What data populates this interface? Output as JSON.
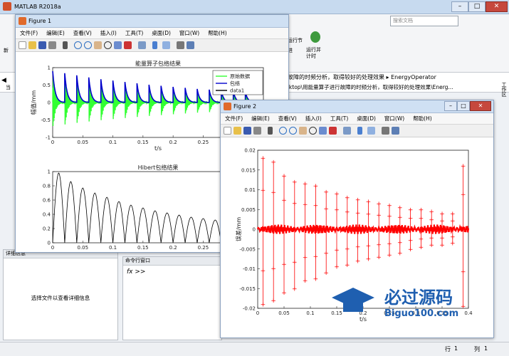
{
  "app": {
    "title": "MATLAB R2018a",
    "search_placeholder": "搜索文档"
  },
  "ribbon": {
    "run_section_label": "运行节",
    "run_advance_label": "运行并\n计时",
    "advance_label": "进"
  },
  "path": {
    "line1": "故障的时频分析，取得较好的处理效果 ▸ EnergyOperator",
    "line2": "sktop\\用能量算子进行故障的时频分析，取得较好的处理效果\\Energ..."
  },
  "side_tab": "工作区",
  "current_folder_short": "当",
  "details_panel": {
    "title": "详细信息",
    "message": "选择文件以查看详细信息"
  },
  "command_window": {
    "title": "命令行窗口",
    "prompt": "fx >>"
  },
  "status": {
    "row_label": "行",
    "row_value": "1",
    "col_label": "列",
    "col_value": "1"
  },
  "figure_menu": [
    "文件(F)",
    "编辑(E)",
    "查看(V)",
    "插入(I)",
    "工具(T)",
    "桌面(D)",
    "窗口(W)",
    "帮助(H)"
  ],
  "figure1": {
    "title": "Figure 1",
    "chart_data": [
      {
        "type": "line",
        "title": "能量算子包络结果",
        "xlabel": "t/s",
        "ylabel": "幅值/mm",
        "xlim": [
          0,
          0.35
        ],
        "ylim": [
          -1,
          1
        ],
        "xticks": [
          "0",
          "0.05",
          "0.1",
          "0.15",
          "0.2",
          "0.25",
          "0.3"
        ],
        "yticks": [
          "-1",
          "-0.5",
          "0",
          "0.5",
          "1"
        ],
        "legend_position": "top-right",
        "series": [
          {
            "name": "原始数据",
            "color": "#33ff33",
            "style": "damped oscillation bursts",
            "peak_envelope": [
              0.88,
              0.82,
              0.76,
              0.71,
              0.66,
              0.62,
              0.58,
              0.54,
              0.5,
              0.47,
              0.44,
              0.41,
              0.38,
              0.36,
              0.34,
              0.32,
              0.3
            ]
          },
          {
            "name": "包络",
            "color": "#0000cc",
            "peak_envelope": [
              0.9,
              0.84,
              0.78,
              0.72,
              0.67,
              0.63,
              0.59,
              0.55,
              0.51,
              0.48,
              0.45,
              0.42,
              0.39,
              0.37,
              0.35,
              0.33,
              0.31
            ]
          },
          {
            "name": "data1",
            "color": "#000000"
          }
        ],
        "burst_period_s": 0.02
      },
      {
        "type": "line",
        "title": "Hibert包络结果",
        "xlabel": "",
        "ylabel": "",
        "xlim": [
          0,
          0.35
        ],
        "ylim": [
          0,
          1
        ],
        "xticks": [
          "0",
          "0.05",
          "0.1",
          "0.15",
          "0.2",
          "0.25",
          "0.3"
        ],
        "yticks": [
          "0",
          "0.2",
          "0.4",
          "0.6",
          "0.8",
          "1"
        ],
        "series": [
          {
            "name": "",
            "color": "#000000",
            "arch_peaks": [
              0.98,
              0.86,
              0.77,
              0.7,
              0.64,
              0.58,
              0.53,
              0.49,
              0.45,
              0.42,
              0.39,
              0.36,
              0.34,
              0.32,
              0.3,
              0.28,
              0.27
            ]
          }
        ],
        "burst_period_s": 0.02
      }
    ]
  },
  "figure2": {
    "title": "Figure 2",
    "chart_data": {
      "type": "line",
      "title": "",
      "xlabel": "t/s",
      "ylabel": "误差/mm",
      "xlim": [
        0,
        0.4
      ],
      "ylim": [
        -0.02,
        0.02
      ],
      "xticks": [
        "0",
        "0.05",
        "0.1",
        "0.15",
        "0.2",
        "0.25",
        "0.3",
        "0.35",
        "0.4"
      ],
      "yticks": [
        "-0.02",
        "-0.015",
        "-0.01",
        "-0.005",
        "0",
        "0.005",
        "0.01",
        "0.015",
        "0.02"
      ],
      "series": [
        {
          "name": "",
          "color": "#ff0000",
          "marker": "+",
          "spike_times": [
            0.01,
            0.03,
            0.05,
            0.07,
            0.09,
            0.11,
            0.13,
            0.15,
            0.17,
            0.19,
            0.21,
            0.23,
            0.25,
            0.27,
            0.29,
            0.31,
            0.33,
            0.35,
            0.37,
            0.39
          ],
          "spike_max": [
            0.018,
            0.017,
            0.0135,
            0.012,
            0.0115,
            0.011,
            0.0095,
            0.009,
            0.008,
            0.0075,
            0.007,
            0.0065,
            0.006,
            0.0055,
            0.005,
            0.005,
            0.0045,
            0.004,
            0.004,
            0.016
          ],
          "spike_min": [
            -0.019,
            -0.018,
            -0.016,
            -0.015,
            -0.013,
            -0.0125,
            -0.011,
            -0.0095,
            -0.009,
            -0.008,
            -0.0075,
            -0.007,
            -0.0065,
            -0.006,
            -0.005,
            -0.0045,
            -0.004,
            -0.004,
            -0.0035,
            -0.0195
          ]
        }
      ]
    }
  },
  "watermark": {
    "brand": "必过源码",
    "url": "Biguo100.com"
  }
}
